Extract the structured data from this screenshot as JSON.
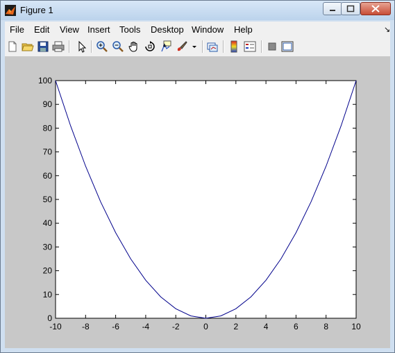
{
  "window": {
    "title": "Figure 1"
  },
  "menu": {
    "items": [
      "File",
      "Edit",
      "View",
      "Insert",
      "Tools",
      "Desktop",
      "Window",
      "Help"
    ],
    "arrow": "↘"
  },
  "toolbar": {
    "icons": [
      "new-figure-icon",
      "open-file-icon",
      "save-icon",
      "print-icon",
      "select-arrow-icon",
      "zoom-in-icon",
      "zoom-out-icon",
      "pan-hand-icon",
      "rotate-3d-icon",
      "data-cursor-icon",
      "brush-icon",
      "brush-dropdown-icon",
      "link-plot-icon",
      "colorbar-icon",
      "legend-icon",
      "hide-plot-tools-icon",
      "show-plot-tools-icon"
    ]
  },
  "colors": {
    "titlebar": "#bcd3ec",
    "figure_bg": "#c8c8c8",
    "line": "#00008b",
    "close_button": "#c74c36"
  },
  "chart_data": {
    "type": "line",
    "title": "",
    "xlabel": "",
    "ylabel": "",
    "xlim": [
      -10,
      10
    ],
    "ylim": [
      0,
      100
    ],
    "xticks": [
      -10,
      -8,
      -6,
      -4,
      -2,
      0,
      2,
      4,
      6,
      8,
      10
    ],
    "yticks": [
      0,
      10,
      20,
      30,
      40,
      50,
      60,
      70,
      80,
      90,
      100
    ],
    "grid": false,
    "series": [
      {
        "x": [
          -10,
          -9,
          -8,
          -7,
          -6,
          -5,
          -4,
          -3,
          -2,
          -1,
          0,
          1,
          2,
          3,
          4,
          5,
          6,
          7,
          8,
          9,
          10
        ],
        "y": [
          100,
          81,
          64,
          49,
          36,
          25,
          16,
          9,
          4,
          1,
          0,
          1,
          4,
          9,
          16,
          25,
          36,
          49,
          64,
          81,
          100
        ]
      }
    ]
  }
}
